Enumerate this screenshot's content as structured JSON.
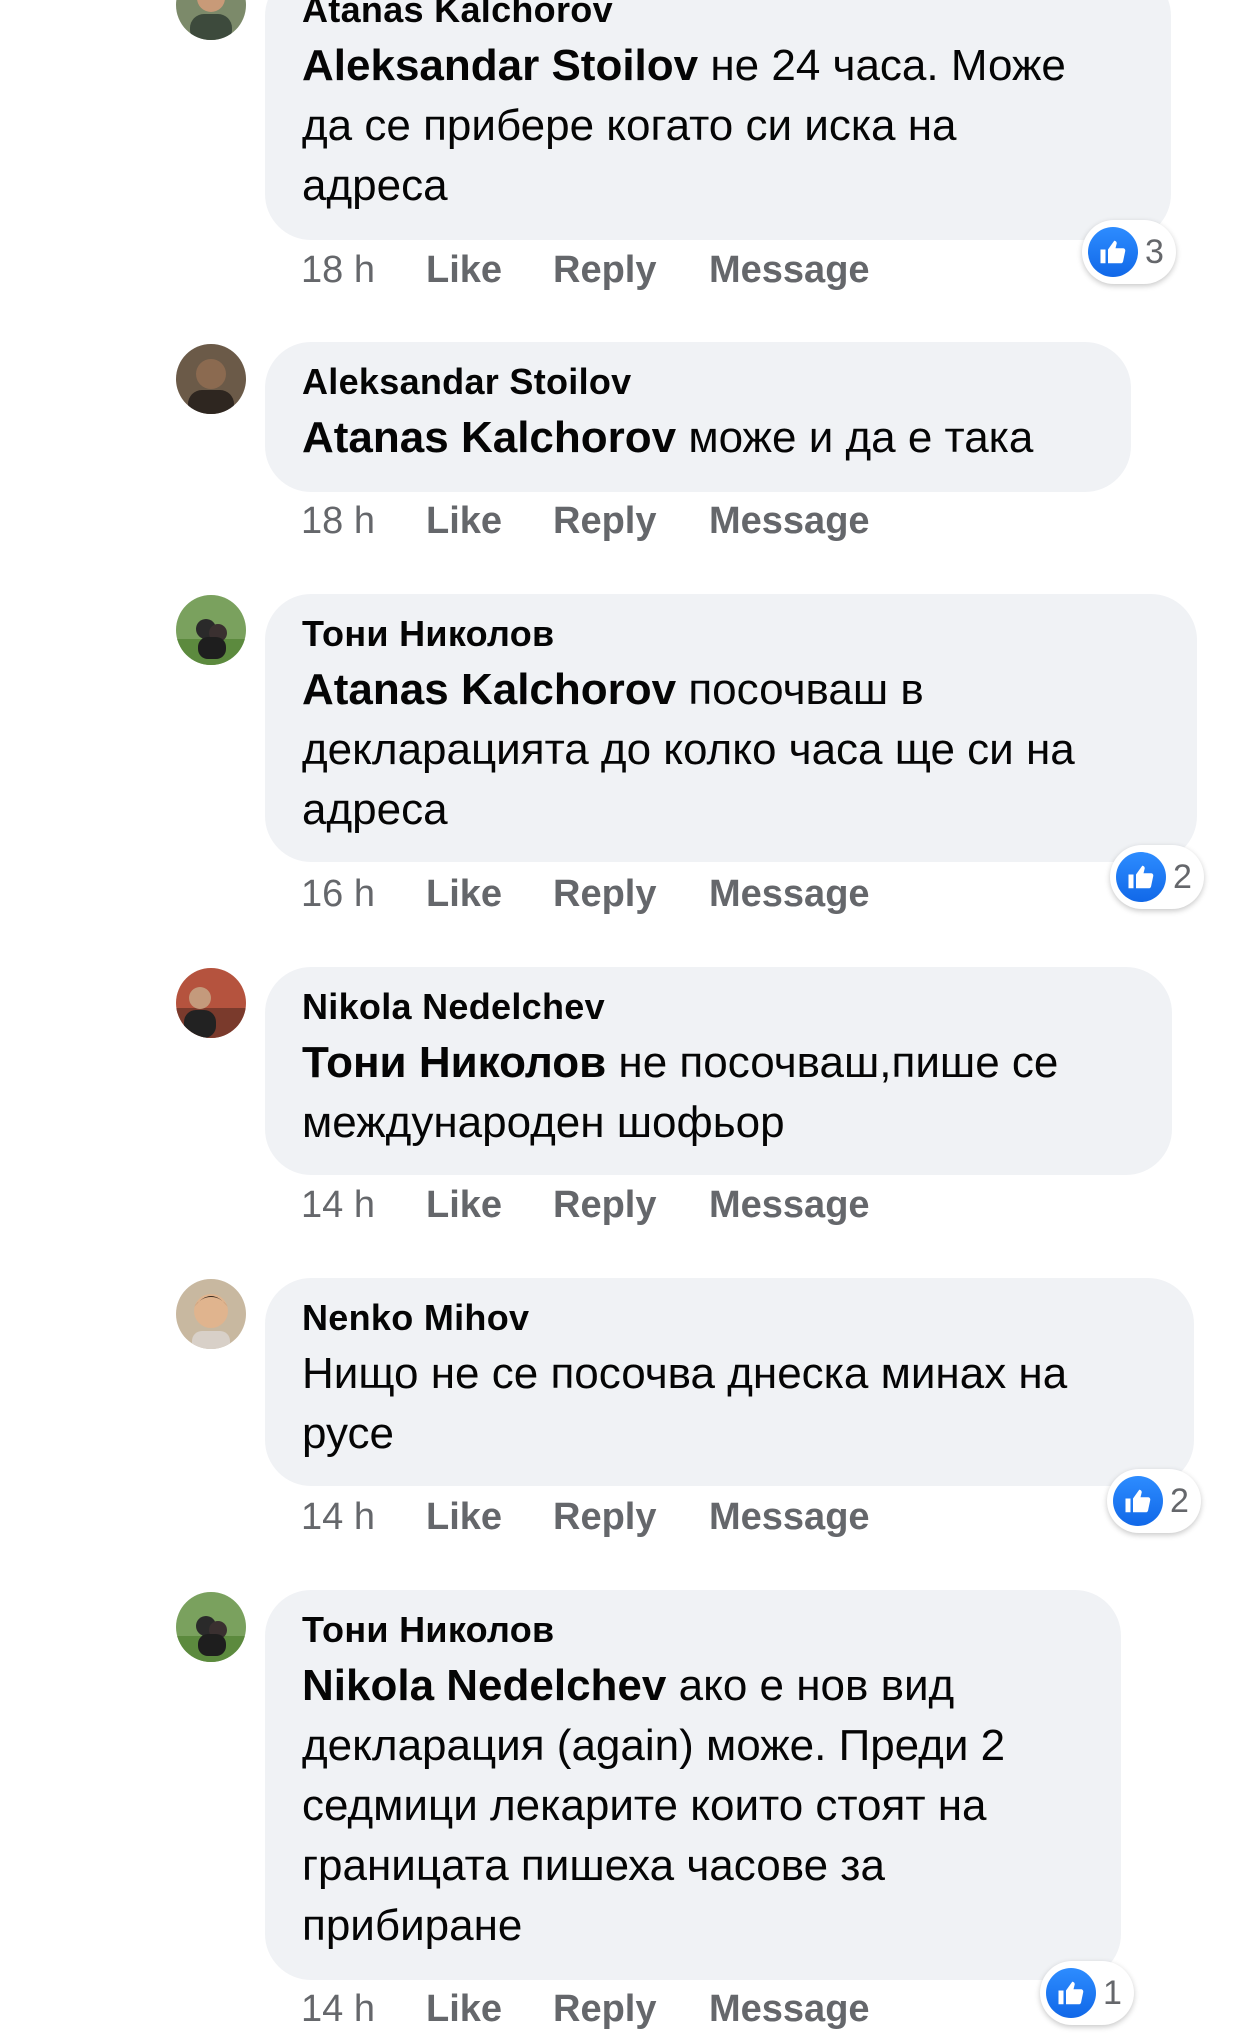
{
  "actions": {
    "like": "Like",
    "reply": "Reply",
    "message": "Message"
  },
  "colors": {
    "bubble": "#f0f2f5",
    "meta_text": "#65676b",
    "like_blue": "#1877f2"
  },
  "comments": [
    {
      "author": "Atanas Kalchorov",
      "mention": "Aleksandar Stoilov",
      "text": " не 24 часа. Може\nда се прибере когато си иска на\nадреса",
      "time": "18 h",
      "reactions": {
        "icon": "like-icon",
        "count": "3"
      }
    },
    {
      "author": "Aleksandar Stoilov",
      "mention": "Atanas Kalchorov",
      "text": " може и да е така",
      "time": "18 h"
    },
    {
      "author": "Тони Николов",
      "mention": "Atanas Kalchorov",
      "text": " посочваш в\nдекларацията до колко часа ще си на\nадреса",
      "time": "16 h",
      "reactions": {
        "icon": "like-icon",
        "count": "2"
      }
    },
    {
      "author": "Nikola Nedelchev",
      "mention": "Тони Николов",
      "text": " не посочваш,пише се\nмеждународен шофьор",
      "time": "14 h"
    },
    {
      "author": "Nenko Mihov",
      "mention": "",
      "text": "Нищо не се посочва днеска минах на\nрусе",
      "time": "14 h",
      "reactions": {
        "icon": "like-icon",
        "count": "2"
      }
    },
    {
      "author": "Тони Николов",
      "mention": "Nikola Nedelchev",
      "text": " ако е нов вид\nдекларация (again) може. Преди 2\nседмици лекарите които стоят на\nграницата пишеха часове за\nприбиране",
      "time": "14 h",
      "reactions": {
        "icon": "like-icon",
        "count": "1"
      }
    }
  ]
}
